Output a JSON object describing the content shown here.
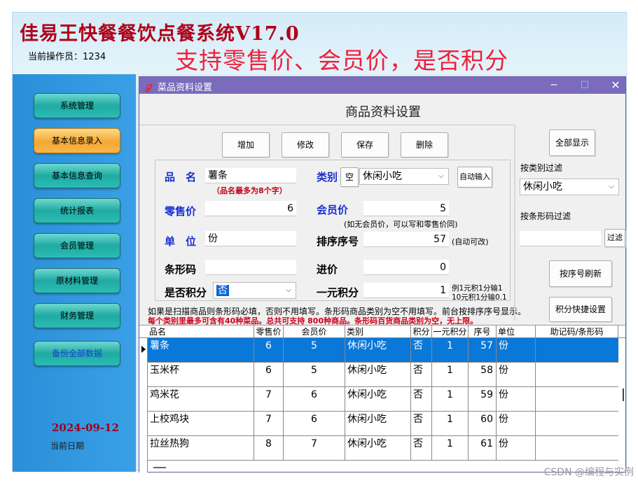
{
  "app": {
    "title": "佳易王快餐餐饮点餐系统V17.0",
    "operator": "当前操作员：1234",
    "banner": "支持零售价、会员价，是否积分"
  },
  "sidebar": {
    "items": [
      {
        "label": "系统管理"
      },
      {
        "label": "基本信息录入"
      },
      {
        "label": "基本信息查询"
      },
      {
        "label": "统计报表"
      },
      {
        "label": "会员管理"
      },
      {
        "label": "原材料管理"
      },
      {
        "label": "财务管理"
      },
      {
        "label": "备份全部数据"
      }
    ],
    "date": "2024-09-12",
    "date_label": "当前日期"
  },
  "dialog": {
    "title": "菜品资料设置",
    "section_title": "商品资料设置",
    "buttons": {
      "add": "增加",
      "edit": "修改",
      "save": "保存",
      "delete": "删除"
    },
    "form": {
      "name_label": "品　名",
      "name_value": "薯条",
      "name_note": "（品名最多为8个字）",
      "category_label": "类别",
      "category_empty_btn": "空",
      "category_value": "休闲小吃",
      "auto_input_btn": "自动输入",
      "retail_label": "零售价",
      "retail_value": "6",
      "member_label": "会员价",
      "member_value": "5",
      "member_note": "(如无会员价，可以写和零售价同)",
      "unit_label": "单　位",
      "unit_value": "份",
      "sort_label": "排序序号",
      "sort_value": "57",
      "sort_note": "(自动可改)",
      "barcode_label": "条形码",
      "barcode_value": "",
      "cost_label": "进价",
      "cost_value": "0",
      "points_label": "是否积分",
      "points_value": "否",
      "yuan_points_label": "一元积分",
      "yuan_points_value": "1",
      "yuan_points_note1": "例1元积1分输1",
      "yuan_points_note2": "10元积1分输0.1"
    },
    "info1": "如果是扫描商品则条形码必填，否则不用填写。条形码商品类别为空不用填写。前台按排序序号显示。",
    "info2": "每个类别里最多可含有40种菜品。总共可支持 800种商品。条形码百货商品类别为空，无上限。",
    "right": {
      "show_all": "全部显示",
      "filter_category_label": "按类别过滤",
      "filter_category_value": "休闲小吃",
      "filter_barcode_label": "按条形码过滤",
      "filter_barcode_value": "",
      "filter_btn": "过滤",
      "refresh_btn": "按序号刷新",
      "points_btn": "积分快捷设置"
    }
  },
  "table": {
    "headers": [
      "品名",
      "零售价",
      "会员价",
      "类别",
      "积分",
      "一元积分",
      "序号",
      "单位",
      "助记码/条形码"
    ],
    "rows": [
      [
        "薯条",
        "6",
        "5",
        "休闲小吃",
        "否",
        "1",
        "57",
        "份",
        ""
      ],
      [
        "玉米杯",
        "6",
        "5",
        "休闲小吃",
        "否",
        "1",
        "58",
        "份",
        ""
      ],
      [
        "鸡米花",
        "7",
        "6",
        "休闲小吃",
        "否",
        "1",
        "59",
        "份",
        ""
      ],
      [
        "上校鸡块",
        "7",
        "6",
        "休闲小吃",
        "否",
        "1",
        "60",
        "份",
        ""
      ],
      [
        "拉丝热狗",
        "8",
        "7",
        "休闲小吃",
        "否",
        "1",
        "61",
        "份",
        ""
      ]
    ]
  },
  "watermark": "CSDN @编程与实例"
}
